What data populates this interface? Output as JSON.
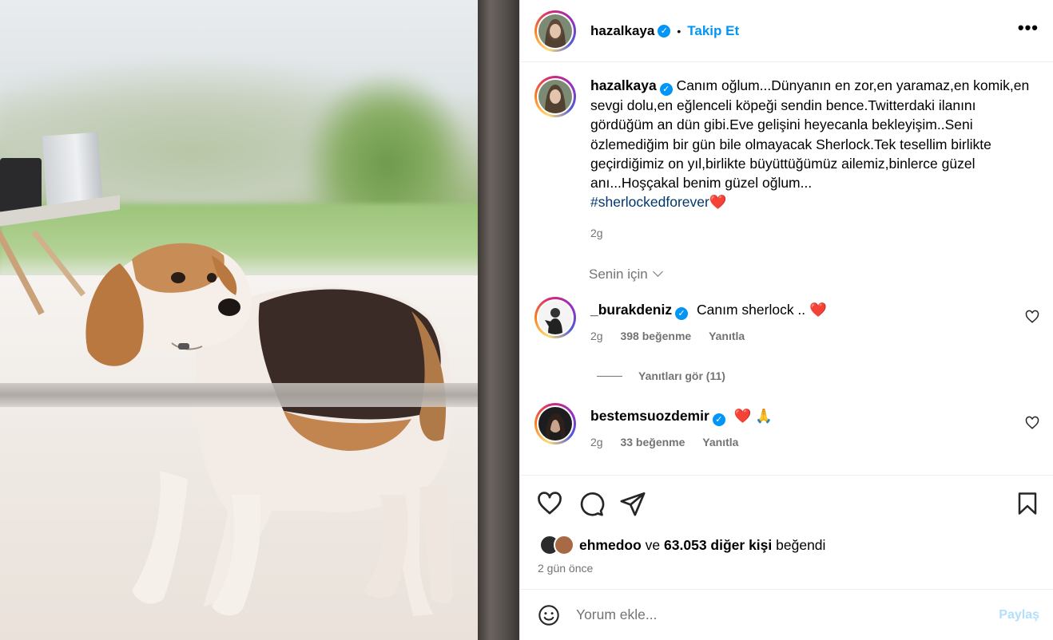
{
  "post": {
    "username": "hazalkaya",
    "follow_label": "Takip Et",
    "dot": "•",
    "more": "•••",
    "caption": "Canım oğlum...Dünyanın en zor,en yaramaz,en komik,en sevgi dolu,en eğlenceli köpeği sendin bence.Twitterdaki ilanını gördüğüm an dün gibi.Eve gelişini heyecanla bekleyişim..Seni özlemediğim bir gün bile olmayacak Sherlock.Tek tesellim birlikte geçirdiğimiz on yıl,birlikte büyüttüğümüz ailemiz,binlerce güzel anı...Hoşçakal benim güzel oğlum...",
    "hashtag": "#sherlockedforever",
    "caption_emoji": "❤️",
    "caption_time": "2g"
  },
  "filter": {
    "label": "Senin için"
  },
  "comments": [
    {
      "username": "_burakdeniz",
      "text": "Canım sherlock ..",
      "emoji": "❤️",
      "time": "2g",
      "likes": "398 beğenme",
      "reply": "Yanıtla",
      "view_replies": "Yanıtları gör (11)"
    },
    {
      "username": "bestemsuozdemir",
      "text": "",
      "emoji": "❤️ 🙏",
      "time": "2g",
      "likes": "33 beğenme",
      "reply": "Yanıtla"
    }
  ],
  "likes": {
    "liker": "ehmedoo",
    "and": "ve",
    "others": "63.053 diğer kişi",
    "suffix": "beğendi"
  },
  "time_ago": "2 gün önce",
  "compose": {
    "placeholder": "Yorum ekle...",
    "post_label": "Paylaş"
  },
  "icons": {
    "header_more": "more-horizontal-icon",
    "verified": "verified-badge-icon",
    "like": "heart-icon",
    "comment": "comment-bubble-icon",
    "share": "paper-plane-icon",
    "save": "bookmark-icon",
    "emoji": "smiley-icon"
  },
  "colors": {
    "accent": "#0095f6",
    "link": "#00376b",
    "muted": "#737373",
    "heart": "#ed1c3c",
    "post_disabled": "#b2dffc"
  }
}
